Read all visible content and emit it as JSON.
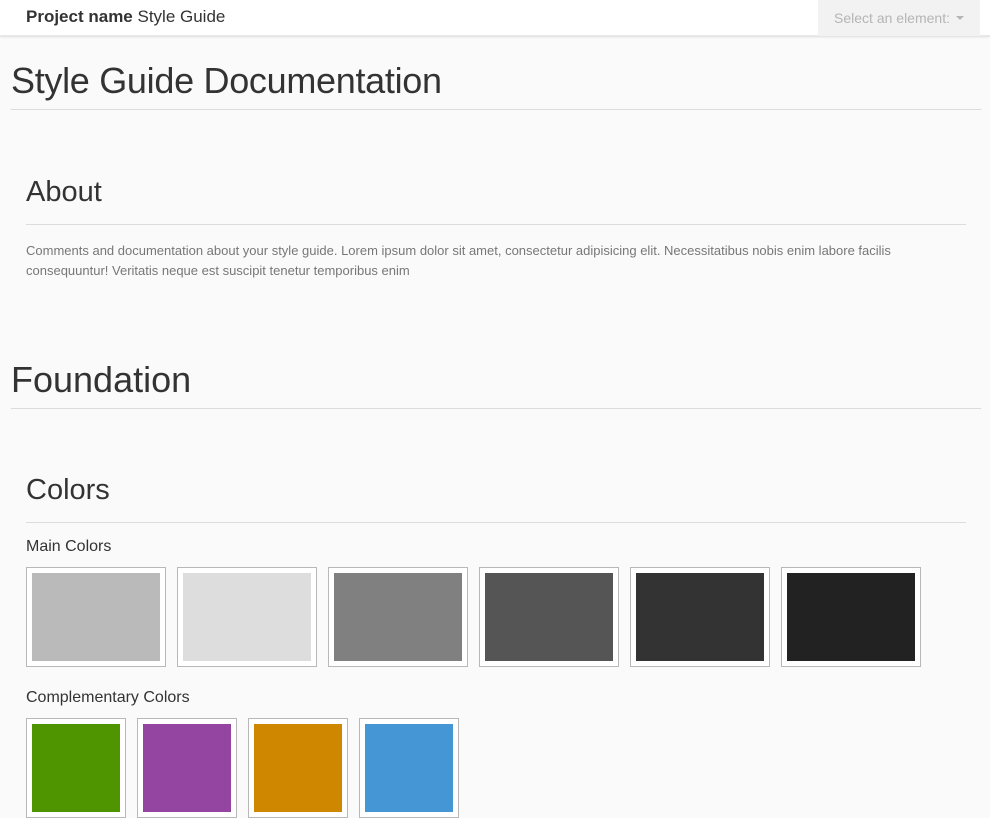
{
  "navbar": {
    "brand_bold": "Project name",
    "brand_rest": " Style Guide",
    "select_label": "Select an element:"
  },
  "page": {
    "title": "Style Guide Documentation"
  },
  "about": {
    "heading": "About",
    "text": "Comments and documentation about your style guide. Lorem ipsum dolor sit amet, consectetur adipisicing elit. Necessitatibus nobis enim labore facilis consequuntur! Veritatis neque est suscipit tenetur temporibus enim"
  },
  "foundation": {
    "heading": "Foundation",
    "colors": {
      "heading": "Colors",
      "main_label": "Main Colors",
      "main": [
        "#bababa",
        "#dddddd",
        "#808080",
        "#555555",
        "#333333",
        "#222222"
      ],
      "complementary_label": "Complementary Colors",
      "complementary": [
        "#4f9500",
        "#9444a1",
        "#d08700",
        "#4596d4"
      ]
    }
  }
}
